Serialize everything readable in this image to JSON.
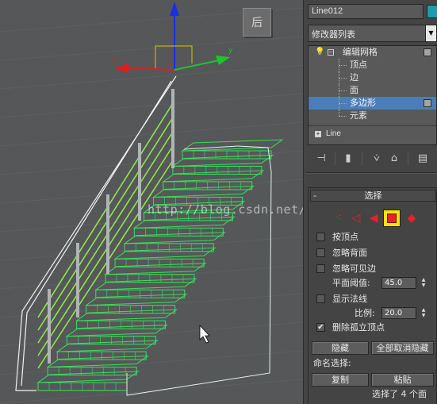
{
  "viewport": {
    "watermark": "http://blog.csdn.net/",
    "viewcube_label": "后",
    "gizmo": {
      "x_label": "x",
      "y_label": "y"
    }
  },
  "panel": {
    "object_name": "Line012",
    "object_color": "#1b9cb1",
    "modifier_list": "修改器列表",
    "stack": {
      "top_item": "编辑网格",
      "sub_items": [
        "顶点",
        "边",
        "面",
        "多边形",
        "元素"
      ],
      "selected": "多边形",
      "base_object": "Line"
    },
    "selection": {
      "title": "选择",
      "level_icons": [
        "vertex-icon",
        "edge-icon",
        "face-icon",
        "polygon-icon",
        "element-icon"
      ],
      "active_level": "polygon-icon",
      "by_vertex": "按顶点",
      "ignore_backfacing": "忽略背面",
      "ignore_visible_edges": "忽略可见边",
      "planar_threshold_label": "平面阈值:",
      "planar_threshold_value": "45.0",
      "show_normals": "显示法线",
      "scale_label": "比例:",
      "scale_value": "20.0",
      "delete_isolated": "删除孤立顶点",
      "delete_isolated_checked": true,
      "hide_button": "隐藏",
      "unhide_all_button": "全部取消隐藏",
      "named_selections_label": "命名选择:",
      "copy_button": "复制",
      "paste_button": "粘贴",
      "status": "选择了 4 个面"
    }
  },
  "colors": {
    "accent_selected": "#4b7db9",
    "active_level_bg": "#f7e500",
    "mesh_green": "#39e05a",
    "glass_green": "#8fe84c"
  }
}
